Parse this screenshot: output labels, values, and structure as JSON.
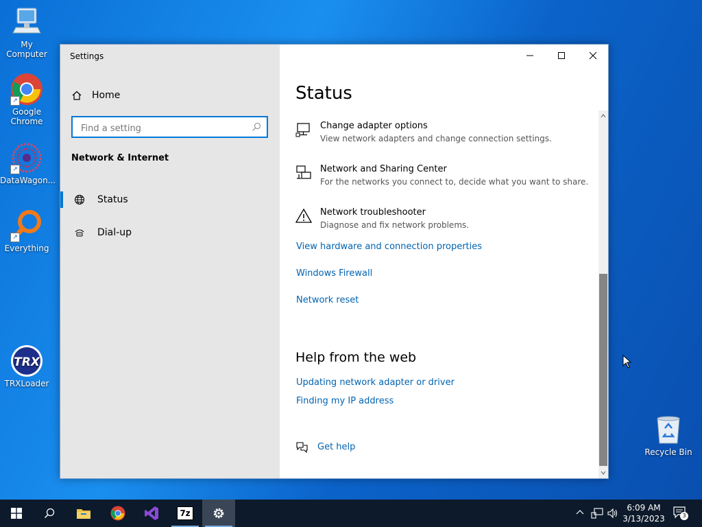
{
  "desktop": {
    "icons": [
      {
        "label": "My Computer"
      },
      {
        "label": "Google Chrome"
      },
      {
        "label": "DataWagon..."
      },
      {
        "label": "Everything"
      },
      {
        "label": "TRXLoader"
      },
      {
        "label": "Recycle Bin"
      }
    ]
  },
  "window": {
    "title": "Settings"
  },
  "nav": {
    "home_label": "Home",
    "search_placeholder": "Find a setting",
    "search_value": "",
    "section_title": "Network & Internet",
    "items": [
      {
        "label": "Status",
        "selected": true
      },
      {
        "label": "Dial-up",
        "selected": false
      }
    ]
  },
  "content": {
    "page_title": "Status",
    "options": [
      {
        "title": "Change adapter options",
        "desc": "View network adapters and change connection settings."
      },
      {
        "title": "Network and Sharing Center",
        "desc": "For the networks you connect to, decide what you want to share."
      },
      {
        "title": "Network troubleshooter",
        "desc": "Diagnose and fix network problems."
      }
    ],
    "links": [
      "View hardware and connection properties",
      "Windows Firewall",
      "Network reset"
    ],
    "help_title": "Help from the web",
    "help_links": [
      "Updating network adapter or driver",
      "Finding my IP address"
    ],
    "get_help_label": "Get help"
  },
  "taskbar": {
    "apps": [
      "start-icon",
      "search-icon",
      "file-explorer-icon",
      "chrome-icon",
      "visual-studio-icon",
      "7zip-icon",
      "settings-icon"
    ],
    "sevenzip_label": "7z",
    "clock_time": "6:09 AM",
    "clock_date": "3/13/2023",
    "notification_count": "3"
  },
  "colors": {
    "accent": "#0078d7",
    "link": "#0063b1",
    "nav_bg": "#e6e6e6"
  }
}
